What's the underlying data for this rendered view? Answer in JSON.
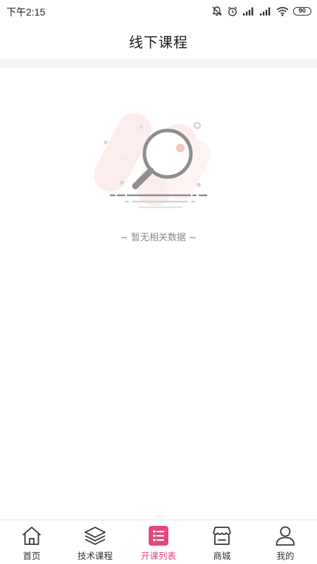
{
  "status_bar": {
    "time": "下午2:15",
    "battery": "90",
    "icons": [
      "mute-bell-icon",
      "alarm-icon",
      "signal-icon",
      "signal-icon",
      "wifi-icon",
      "battery-icon"
    ]
  },
  "header": {
    "title": "线下课程"
  },
  "empty_state": {
    "illustration": "magnifier-icon",
    "message": "~ 暂无相关数据 ~"
  },
  "tab_bar": {
    "active_color": "#e8457a",
    "items": [
      {
        "label": "首页",
        "icon": "home-icon"
      },
      {
        "label": "技术课程",
        "icon": "layers-icon"
      },
      {
        "label": "开课列表",
        "icon": "list-icon",
        "active": true
      },
      {
        "label": "商城",
        "icon": "store-icon"
      },
      {
        "label": "我的",
        "icon": "user-icon"
      }
    ]
  }
}
